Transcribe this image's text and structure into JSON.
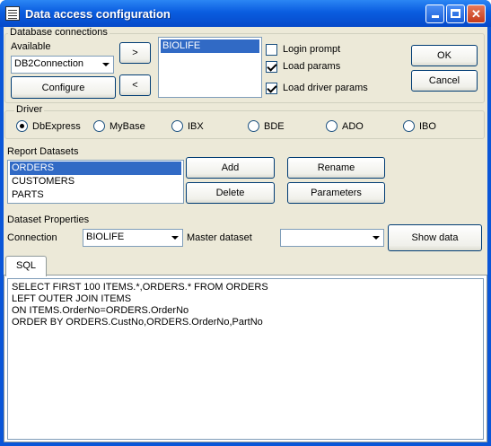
{
  "window": {
    "title": "Data access configuration"
  },
  "database_connections": {
    "legend": "Database connections",
    "available_label": "Available",
    "available_value": "DB2Connection",
    "configure_label": "Configure",
    "move_right_label": ">",
    "move_left_label": "<",
    "selected_connections": [
      "BIOLIFE"
    ],
    "login_prompt_label": "Login prompt",
    "login_prompt_checked": false,
    "load_params_label": "Load params",
    "load_params_checked": true,
    "load_driver_params_label": "Load driver params",
    "load_driver_params_checked": true
  },
  "buttons": {
    "ok": "OK",
    "cancel": "Cancel"
  },
  "driver": {
    "legend": "Driver",
    "options": [
      "DbExpress",
      "MyBase",
      "IBX",
      "BDE",
      "ADO",
      "IBO"
    ],
    "selected": "DbExpress"
  },
  "report_datasets": {
    "label": "Report Datasets",
    "items": [
      "ORDERS",
      "CUSTOMERS",
      "PARTS"
    ],
    "selected": "ORDERS",
    "add_label": "Add",
    "delete_label": "Delete",
    "rename_label": "Rename",
    "parameters_label": "Parameters"
  },
  "dataset_properties": {
    "label": "Dataset Properties",
    "connection_label": "Connection",
    "connection_value": "BIOLIFE",
    "master_label": "Master dataset",
    "master_value": "",
    "show_data_label": "Show data"
  },
  "sql_tab": {
    "label": "SQL",
    "lines": [
      "SELECT FIRST 100 ITEMS.*,ORDERS.* FROM ORDERS",
      "LEFT OUTER JOIN ITEMS",
      "ON ITEMS.OrderNo=ORDERS.OrderNo",
      "ORDER BY ORDERS.CustNo,ORDERS.OrderNo,PartNo"
    ]
  }
}
